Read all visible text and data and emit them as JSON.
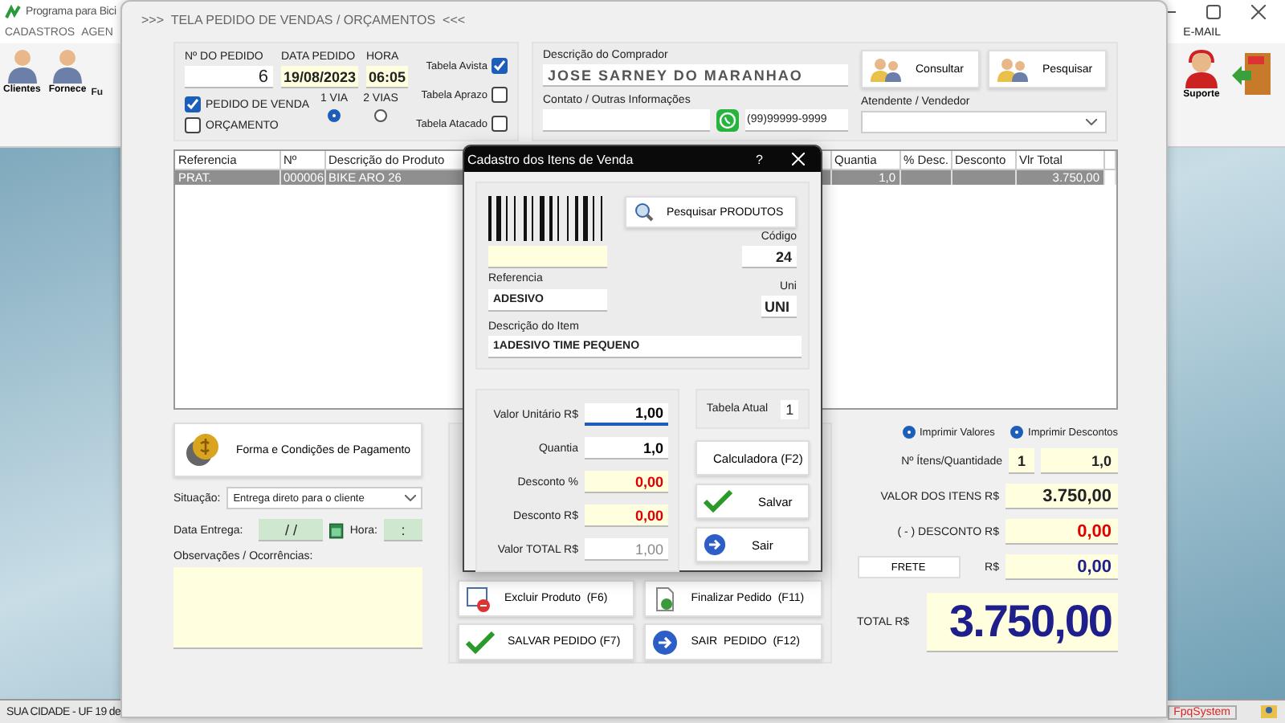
{
  "app": {
    "title": "Programa para Bici",
    "menu_left": [
      "CADASTROS",
      "AGEN"
    ],
    "menu_right": "E-MAIL",
    "toolbar_left": [
      {
        "label": "Clientes",
        "kind": "full"
      },
      {
        "label": "Fornece",
        "kind": "full"
      },
      {
        "label": "Fu",
        "kind": "partial"
      }
    ],
    "toolbar_right": [
      {
        "kind": "support",
        "label": "Suporte"
      },
      {
        "kind": "exit"
      }
    ],
    "status_left": "SUA CIDADE - UF 19 de",
    "status_right": "FpqSystem"
  },
  "window": {
    "title": ">>>  TELA PEDIDO DE VENDAS / ORÇAMENTOS  <<<"
  },
  "order": {
    "number_label": "Nº DO PEDIDO",
    "number": "6",
    "date_label": "DATA PEDIDO",
    "date": "19/08/2023",
    "time_label": "HORA",
    "time": "06:05",
    "doc_types": [
      {
        "label": "PEDIDO DE VENDA",
        "checked": true
      },
      {
        "label": "ORÇAMENTO",
        "checked": false
      }
    ],
    "copies": [
      {
        "label": "1 VIA",
        "selected": true
      },
      {
        "label": "2 VIAS",
        "selected": false
      }
    ],
    "price_tables": [
      {
        "label": "Tabela Avista",
        "checked": true
      },
      {
        "label": "Tabela Aprazo",
        "checked": false
      },
      {
        "label": "Tabela Atacado",
        "checked": false
      }
    ]
  },
  "buyer": {
    "label": "Descrição do Comprador",
    "value": "JOSE SARNEY DO MARANHAO",
    "buttons": [
      "Consultar",
      "Pesquisar"
    ],
    "contact_label": "Contato / Outras Informações",
    "phone": "(99)99999-9999",
    "seller_label": "Atendente / Vendedor"
  },
  "table": {
    "columns": [
      "Referencia",
      "Nº",
      "Descrição do Produto",
      "Quantia",
      "% Desc.",
      "Desconto",
      "Vlr Total"
    ],
    "rows": [
      {
        "reference": "PRAT.",
        "number": "000006",
        "description": "BIKE ARO 26",
        "quantity": "1,0",
        "total": "3.750,00",
        "selected": true
      }
    ]
  },
  "payment_button": "Forma e Condições de Pagamento",
  "situation": {
    "label": "Situação:",
    "value": "Entrega direto para o cliente"
  },
  "delivery": {
    "date_label": "Data Entrega:",
    "date": "/ /",
    "time_label": "Hora:",
    "time": ":"
  },
  "notes_label": "Observações / Ocorrências:",
  "actions": [
    {
      "label": "Excluir Produto  (F6)",
      "kind": "delete"
    },
    {
      "label": "Finalizar Pedido  (F11)",
      "kind": "finish"
    },
    {
      "label": "SALVAR PEDIDO (F7)",
      "kind": "save"
    },
    {
      "label": "SAIR  PEDIDO  (F12)",
      "kind": "exit"
    }
  ],
  "print_options": [
    {
      "label": "Imprimir Valores",
      "selected": true
    },
    {
      "label": "Imprimir Descontos",
      "selected": true
    }
  ],
  "totals": {
    "count_label": "Nº Ítens/Quantidade",
    "count": "1",
    "quantity": "1,0",
    "items_label": "VALOR DOS ITENS R$",
    "items": "3.750,00",
    "discount_label": "( - ) DESCONTO R$",
    "discount": "0,00",
    "freight_button": "FRETE",
    "freight_label": "R$",
    "freight": "0,00",
    "total_label": "TOTAL R$",
    "total": "3.750,00"
  },
  "dialog": {
    "title": "Cadastro dos Itens de Venda",
    "help": "?",
    "search_button": "Pesquisar PRODUTOS",
    "code_label": "Código",
    "code": "24",
    "reference_label": "Referencia",
    "reference": "ADESIVO",
    "unit_label": "Uni",
    "unit": "UNI",
    "description_label": "Descrição do Item",
    "description": "1ADESIVO TIME PEQUENO",
    "fields": [
      {
        "label": "Valor Unitário R$",
        "value": "1,00",
        "kind": "focus"
      },
      {
        "label": "Quantia",
        "value": "1,0",
        "kind": "plain"
      },
      {
        "label": "Desconto %",
        "value": "0,00",
        "kind": "discount"
      },
      {
        "label": "Desconto R$",
        "value": "0,00",
        "kind": "discount"
      },
      {
        "label": "Valor TOTAL R$",
        "value": "1,00",
        "kind": "readonly"
      }
    ],
    "table_label": "Tabela Atual",
    "table_value": "1",
    "buttons": [
      {
        "label": "Calculadora (F2)",
        "kind": "calculator"
      },
      {
        "label": "Salvar",
        "kind": "save"
      },
      {
        "label": "Sair",
        "kind": "exit"
      }
    ]
  }
}
